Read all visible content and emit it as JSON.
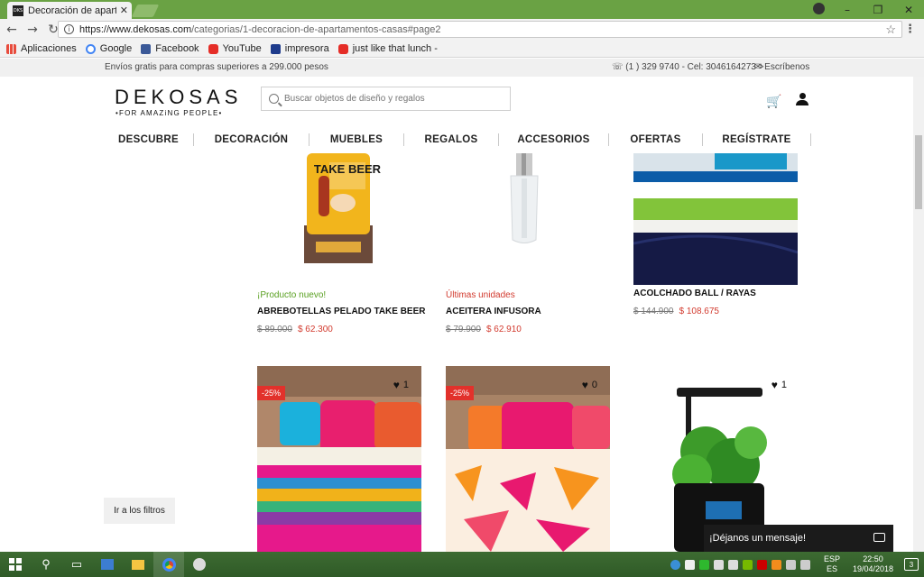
{
  "browser": {
    "tab_title": "Decoración de apartame",
    "tab_favicon": "DKS",
    "url_domain": "https://www.dekosas.com",
    "url_path": "/categorias/1-decoracion-de-apartamentos-casas#page2",
    "bookmarks": [
      {
        "label": "Aplicaciones",
        "icon": "apps-icon"
      },
      {
        "label": "Google",
        "icon": "google-icon"
      },
      {
        "label": "Facebook",
        "icon": "facebook-icon"
      },
      {
        "label": "YouTube",
        "icon": "youtube-icon"
      },
      {
        "label": "impresora",
        "icon": "printer-icon"
      },
      {
        "label": "just like that lunch -",
        "icon": "youtube-icon"
      }
    ]
  },
  "topbar": {
    "shipping": "Envíos gratis para compras superiores a 299.000 pesos",
    "contact": "(1 ) 329 9740 - Cel: 3046164273 >",
    "write": "Escríbenos"
  },
  "header": {
    "logo": "DEKOSAS",
    "logo_tagline": "•FOR AMAZiNG PEOPLE•",
    "search_placeholder": "Buscar objetos de diseño y regalos"
  },
  "nav": [
    "DESCUBRE",
    "DECORACIÓN",
    "MUEBLES",
    "REGALOS",
    "ACCESORIOS",
    "OFERTAS",
    "REGÍSTRATE"
  ],
  "products": [
    {
      "tag": "¡Producto nuevo!",
      "name": "ABREBOTELLAS PELADO TAKE BEER",
      "old_price": "$ 89.000",
      "price": "$ 62.300",
      "image_text": "TAKE BEER"
    },
    {
      "tag": "Últimas unidades",
      "name": "ACEITERA INFUSORA",
      "old_price": "$ 79.900",
      "price": "$ 62.910"
    },
    {
      "tag": "",
      "name": "ACOLCHADO BALL / RAYAS",
      "old_price": "$ 144.900",
      "price": "$ 108.675"
    },
    {
      "discount": "-25%",
      "likes": "1"
    },
    {
      "discount": "-25%",
      "likes": "0"
    },
    {
      "likes": "1"
    }
  ],
  "floating": {
    "filters": "Ir a los filtros",
    "chat": "¡Déjanos un mensaje!"
  },
  "taskbar": {
    "lang_top": "ESP",
    "lang_bottom": "ES",
    "time": "22:50",
    "date": "19/04/2018",
    "notifications": "3"
  },
  "colors": {
    "brand_green_frame": "#6aa244",
    "price_red": "#d23a2e",
    "new_green": "#5aa022",
    "discount_red": "#e2312b"
  }
}
